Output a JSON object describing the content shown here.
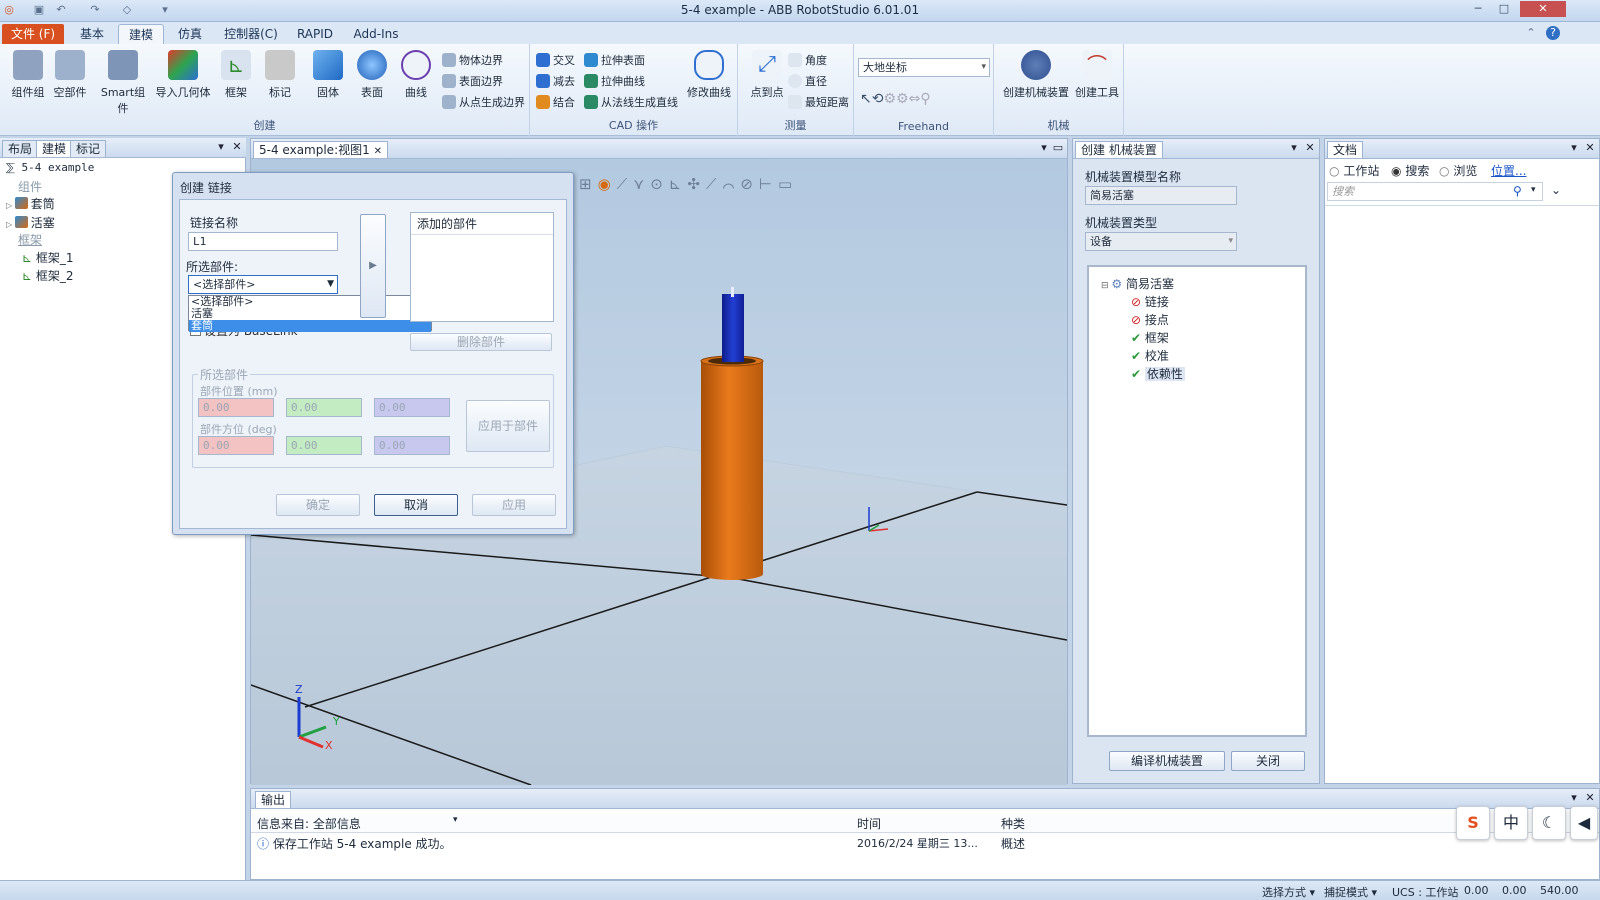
{
  "window": {
    "title": "5-4 example - ABB RobotStudio 6.01.01"
  },
  "tabs": {
    "file": "文件 (F)",
    "items": [
      "基本",
      "建模",
      "仿真",
      "控制器(C)",
      "RAPID",
      "Add-Ins"
    ]
  },
  "ribbon": {
    "create": {
      "label": "创建",
      "buttons": [
        "组件组",
        "空部件",
        "Smart组件",
        "导入几何体",
        "框架",
        "标记",
        "固体",
        "表面",
        "曲线"
      ],
      "small": [
        "物体边界",
        "表面边界",
        "从点生成边界"
      ]
    },
    "cad": {
      "label": "CAD 操作",
      "small": [
        "交叉",
        "减去",
        "结合",
        "拉伸表面",
        "拉伸曲线",
        "从法线生成直线"
      ],
      "big": "修改曲线"
    },
    "measure": {
      "label": "测量",
      "big": "点到点",
      "small": [
        "角度",
        "直径",
        "最短距离"
      ]
    },
    "freehand": {
      "label": "Freehand",
      "coord": "大地坐标"
    },
    "mechanism": {
      "label": "机械",
      "buttons": [
        "创建机械装置",
        "创建工具"
      ]
    }
  },
  "left_panel": {
    "tabs": [
      "布局",
      "建模",
      "标记"
    ],
    "tree": {
      "root": "5-4 example",
      "components_label": "组件",
      "components": [
        "套筒",
        "活塞"
      ],
      "frames_label": "框架",
      "frames": [
        "框架_1",
        "框架_2"
      ]
    }
  },
  "viewport": {
    "tab": "5-4 example:视图1",
    "axes": {
      "x": "X",
      "y": "Y",
      "z": "Z"
    }
  },
  "dialog": {
    "title": "创建 链接",
    "link_name_label": "链接名称",
    "link_name": "L1",
    "selected_part_label": "所选部件:",
    "combo_value": "<选择部件>",
    "dropdown_options": [
      "<选择部件>",
      "活塞",
      "套筒"
    ],
    "behind_checkbox": "设置为 BaseLink",
    "added_parts_header": "添加的部件",
    "delete_part": "删除部件",
    "group_label": "所选部件",
    "position_label": "部件位置 (mm)",
    "orientation_label": "部件方位 (deg)",
    "position": [
      "0.00",
      "0.00",
      "0.00"
    ],
    "orientation": [
      "0.00",
      "0.00",
      "0.00"
    ],
    "apply_to_part": "应用于部件",
    "ok": "确定",
    "cancel": "取消",
    "apply": "应用"
  },
  "mech_panel": {
    "tab": "创建 机械装置",
    "model_name_label": "机械装置模型名称",
    "model_name": "简易活塞",
    "type_label": "机械装置类型",
    "type_value": "设备",
    "tree_root": "简易活塞",
    "tree_items": [
      {
        "label": "链接",
        "status": "error"
      },
      {
        "label": "接点",
        "status": "error"
      },
      {
        "label": "框架",
        "status": "ok"
      },
      {
        "label": "校准",
        "status": "ok"
      },
      {
        "label": "依赖性",
        "status": "ok"
      }
    ],
    "compile_button": "编译机械装置",
    "close_button": "关闭"
  },
  "doc_panel": {
    "tab": "文档",
    "radios": [
      "工作站",
      "搜索",
      "浏览"
    ],
    "location_link": "位置...",
    "search_placeholder": "搜索"
  },
  "output": {
    "tab": "输出",
    "source_label": "信息来自: 全部信息",
    "col_time": "时间",
    "col_type": "种类",
    "message": "保存工作站 5-4 example 成功。",
    "time": "2016/2/24 星期三 13...",
    "kind": "概述"
  },
  "statusbar": {
    "select_mode": "选择方式 ▾",
    "snap_mode": "捕捉模式 ▾",
    "ucs": "UCS : 工作站",
    "coords": [
      "0.00",
      "0.00",
      "540.00"
    ]
  },
  "ime": {
    "cn": "中"
  },
  "colors": {
    "accent_file": "#d8501f",
    "cylinder": "#d66a10",
    "piston": "#1a2fb8",
    "selection": "#3c8ee8"
  }
}
